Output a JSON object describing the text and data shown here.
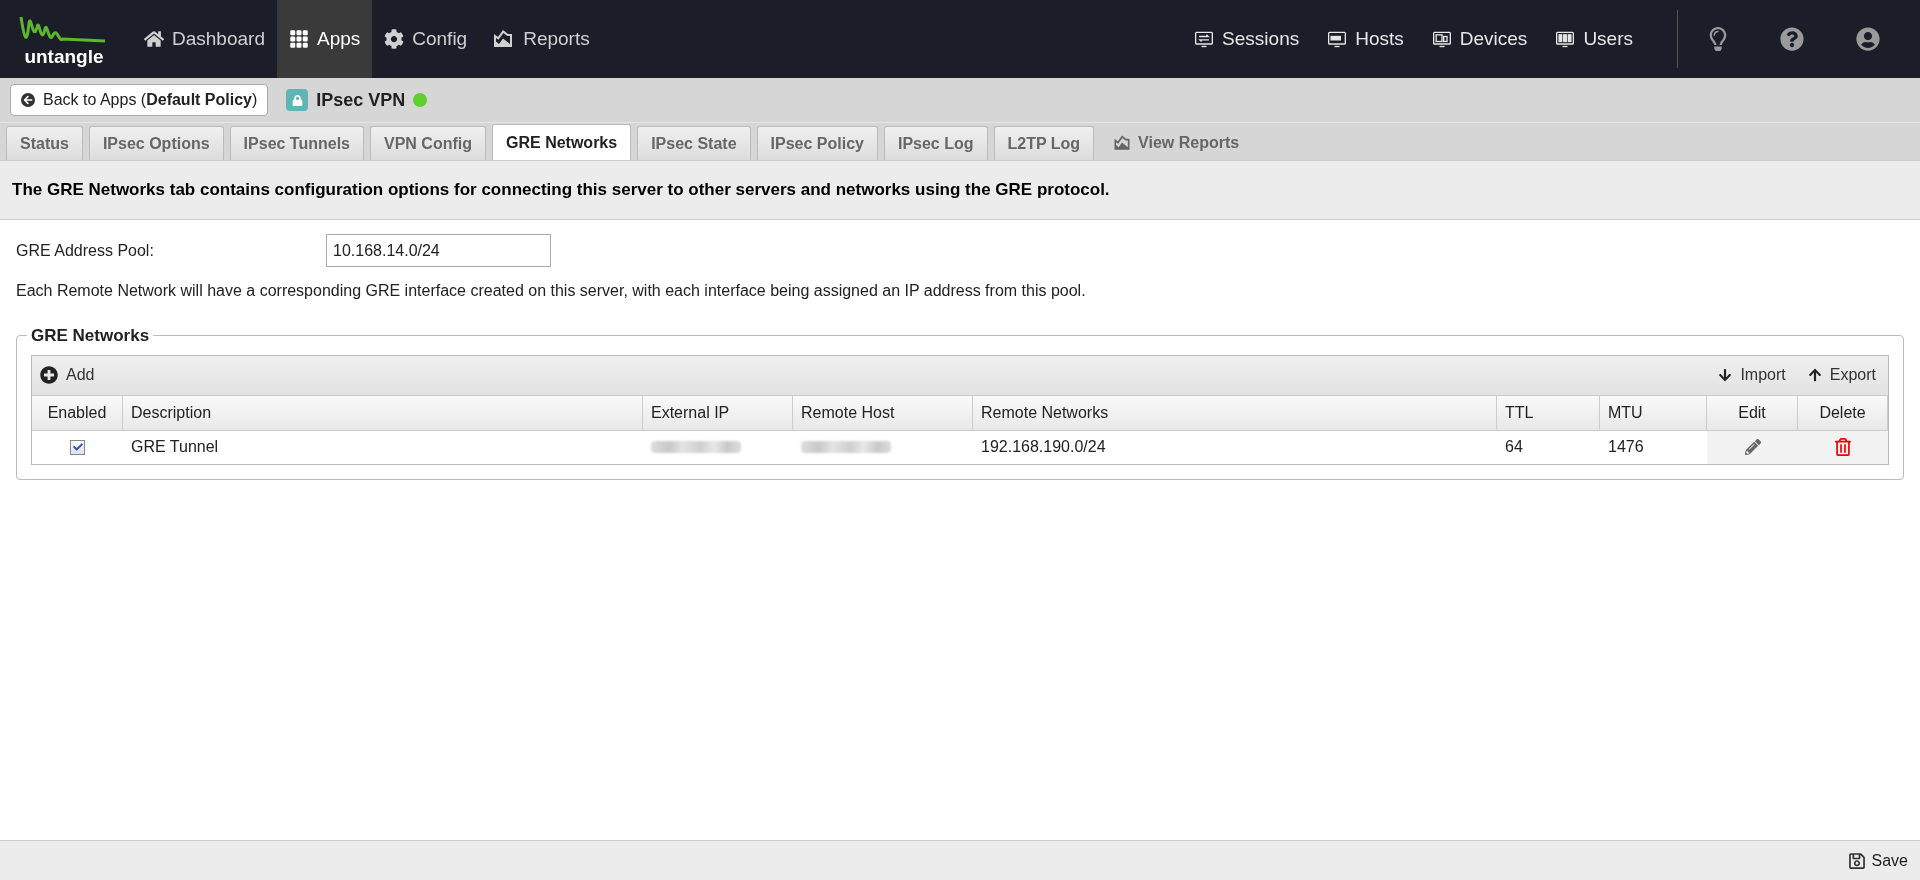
{
  "nav": {
    "items": [
      {
        "label": "Dashboard",
        "selected": false
      },
      {
        "label": "Apps",
        "selected": true
      },
      {
        "label": "Config",
        "selected": false
      },
      {
        "label": "Reports",
        "selected": false
      }
    ],
    "right_items": [
      {
        "label": "Sessions"
      },
      {
        "label": "Hosts"
      },
      {
        "label": "Devices"
      },
      {
        "label": "Users"
      }
    ],
    "logo": "untangle"
  },
  "app_bar": {
    "back_button": "Back to Apps (**Default Policy**)",
    "app_name": "IPsec VPN",
    "running": true
  },
  "tabs": [
    {
      "label": "Status",
      "selected": false
    },
    {
      "label": "IPsec Options",
      "selected": false
    },
    {
      "label": "IPsec Tunnels",
      "selected": false
    },
    {
      "label": "VPN Config",
      "selected": false
    },
    {
      "label": "GRE Networks",
      "selected": true
    },
    {
      "label": "IPsec State",
      "selected": false
    },
    {
      "label": "IPsec Policy",
      "selected": false
    },
    {
      "label": "IPsec Log",
      "selected": false
    },
    {
      "label": "L2TP Log",
      "selected": false
    },
    {
      "label": "View Reports",
      "selected": false,
      "kind": "link"
    }
  ],
  "description": "The GRE Networks tab contains configuration options for connecting this server to other servers and networks using the GRE protocol.",
  "address_pool": {
    "label": "GRE Address Pool:",
    "value": "10.168.14.0/24",
    "help": "Each Remote Network will have a corresponding GRE interface created on this server, with each interface being assigned an IP address from this pool."
  },
  "grid": {
    "title": "GRE Networks",
    "add": "Add",
    "import": "Import",
    "export": "Export",
    "columns": [
      "Enabled",
      "Description",
      "External IP",
      "Remote Host",
      "Remote Networks",
      "TTL",
      "MTU",
      "Edit",
      "Delete"
    ],
    "rows": [
      {
        "enabled": true,
        "description": "GRE Tunnel",
        "remote_networks": "192.168.190.0/24",
        "ttl": "64",
        "mtu": "1476"
      }
    ]
  },
  "footer": {
    "save": "Save"
  }
}
